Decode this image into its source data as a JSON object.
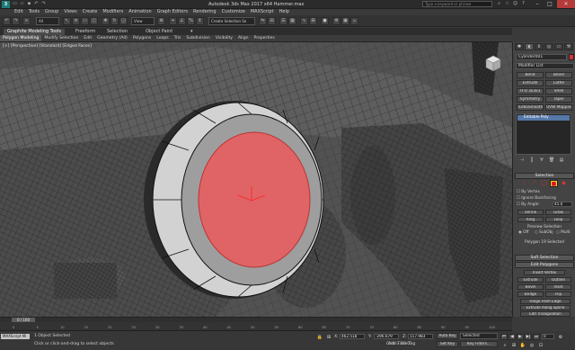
{
  "window": {
    "logo": "3",
    "title": "Autodesk 3ds Max 2017 x64    Hammer.max",
    "search_placeholder": "Type a keyword or phrase",
    "min": "–",
    "max": "□",
    "close": "✕"
  },
  "menu": [
    "Edit",
    "Tools",
    "Group",
    "Views",
    "Create",
    "Modifiers",
    "Animation",
    "Graph Editors",
    "Rendering",
    "Customize",
    "MAXScript",
    "Help"
  ],
  "toolbar": {
    "selection_filter": "All",
    "view_dropdown": "View",
    "named_selection": "Create Selection Se"
  },
  "ribbon": {
    "tabs": [
      "Graphite Modeling Tools",
      "Freeform",
      "Selection",
      "Object Paint"
    ],
    "subtabs": [
      "Polygon Modeling",
      "Modify Selection",
      "Edit",
      "Geometry (All)",
      "Polygons",
      "Loops",
      "Tris",
      "Subdivision",
      "Visibility",
      "Align",
      "Properties"
    ]
  },
  "viewport": {
    "label": "[+] [Perspective] [Standard] [Edged Faces]"
  },
  "panel": {
    "object_name": "Cylinder001",
    "modifier_list": "Modifier List",
    "mod_buttons": [
      "Bend",
      "Bevel",
      "Extrude",
      "Lathe",
      "FFD 3x3x3",
      "Shell",
      "Symmetry",
      "Taper",
      "TurboSmooth",
      "UVW Mapping Cle"
    ],
    "stack_item": "Editable Poly",
    "selection_title": "Selection",
    "by_vertex": "By Vertex",
    "ignore_backfacing": "Ignore Backfacing",
    "by_angle": "By Angle:",
    "by_angle_value": "45.0",
    "shrink": "Shrink",
    "grow": "Grow",
    "ring": "Ring",
    "loop": "Loop",
    "preview_selection": "Preview Selection",
    "preview_off": "Off",
    "preview_subobj": "SubObj",
    "preview_multi": "Multi",
    "polys_selected": "Polygon 19 Selected",
    "soft_selection": "Soft Selection",
    "edit_polygons": "Edit Polygons",
    "insert_vertex": "Insert Vertex",
    "extrude": "Extrude",
    "outline": "Outline",
    "bevel": "Bevel",
    "inset": "Inset",
    "bridge": "Bridge",
    "flip": "Flip",
    "hinge_from_edge": "Hinge From Edge",
    "extrude_along_spline": "Extrude Along Spline",
    "edit_triangulation": "Edit Triangulation",
    "retriangulate": "Retriangulate",
    "turn": "Turn"
  },
  "timeline": {
    "slider": "0 / 100",
    "ticks": [
      "0",
      "5",
      "10",
      "15",
      "20",
      "25",
      "30",
      "35",
      "40",
      "45",
      "50",
      "55",
      "60",
      "65",
      "70",
      "75",
      "80",
      "85",
      "90",
      "95",
      "100"
    ]
  },
  "status": {
    "maxscript": "MAXScript Mi",
    "objects_selected": "1 Object Selected",
    "prompt": "Click or click-and-drag to select objects",
    "x_label": "X:",
    "x_value": "462.518",
    "y_label": "Y:",
    "y_value": "-296.679",
    "z_label": "Z:",
    "z_value": "117.983",
    "grid": "Grid = 10.0",
    "add_time_tag": "Add Time Tag",
    "auto_key": "Auto Key",
    "selected": "Selected",
    "set_key": "Set Key",
    "key_filters": "Key Filters...",
    "frame": "0"
  }
}
